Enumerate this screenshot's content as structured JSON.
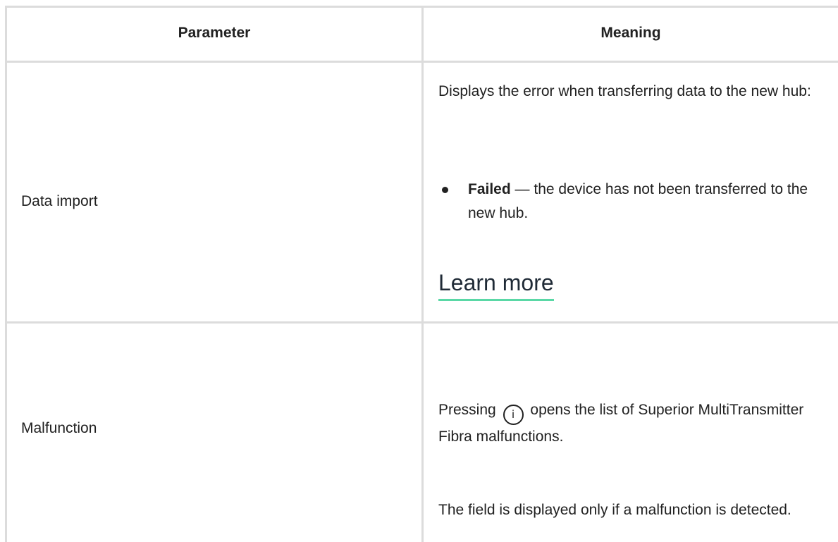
{
  "table": {
    "headers": {
      "parameter": "Parameter",
      "meaning": "Meaning"
    },
    "rows": [
      {
        "parameter": "Data import",
        "meaning_text": "Displays the error when transferring data to the new hub:",
        "bullet": {
          "term": "Failed",
          "dash": " — ",
          "text": "the device has not been transferred to the new hub."
        },
        "link": "Learn more"
      },
      {
        "parameter": "Malfunction",
        "meaning_prefix": "Pressing",
        "icon_glyph": "i",
        "meaning_suffix": "opens the list of Superior MultiTransmitter Fibra malfunctions.",
        "note": "The field is displayed only if a malfunction is detected."
      }
    ]
  },
  "colors": {
    "link_underline": "#5ad8a6",
    "grid": "#dcdcdc",
    "text": "#212121"
  },
  "icons": {
    "info": "info-circle-icon"
  }
}
